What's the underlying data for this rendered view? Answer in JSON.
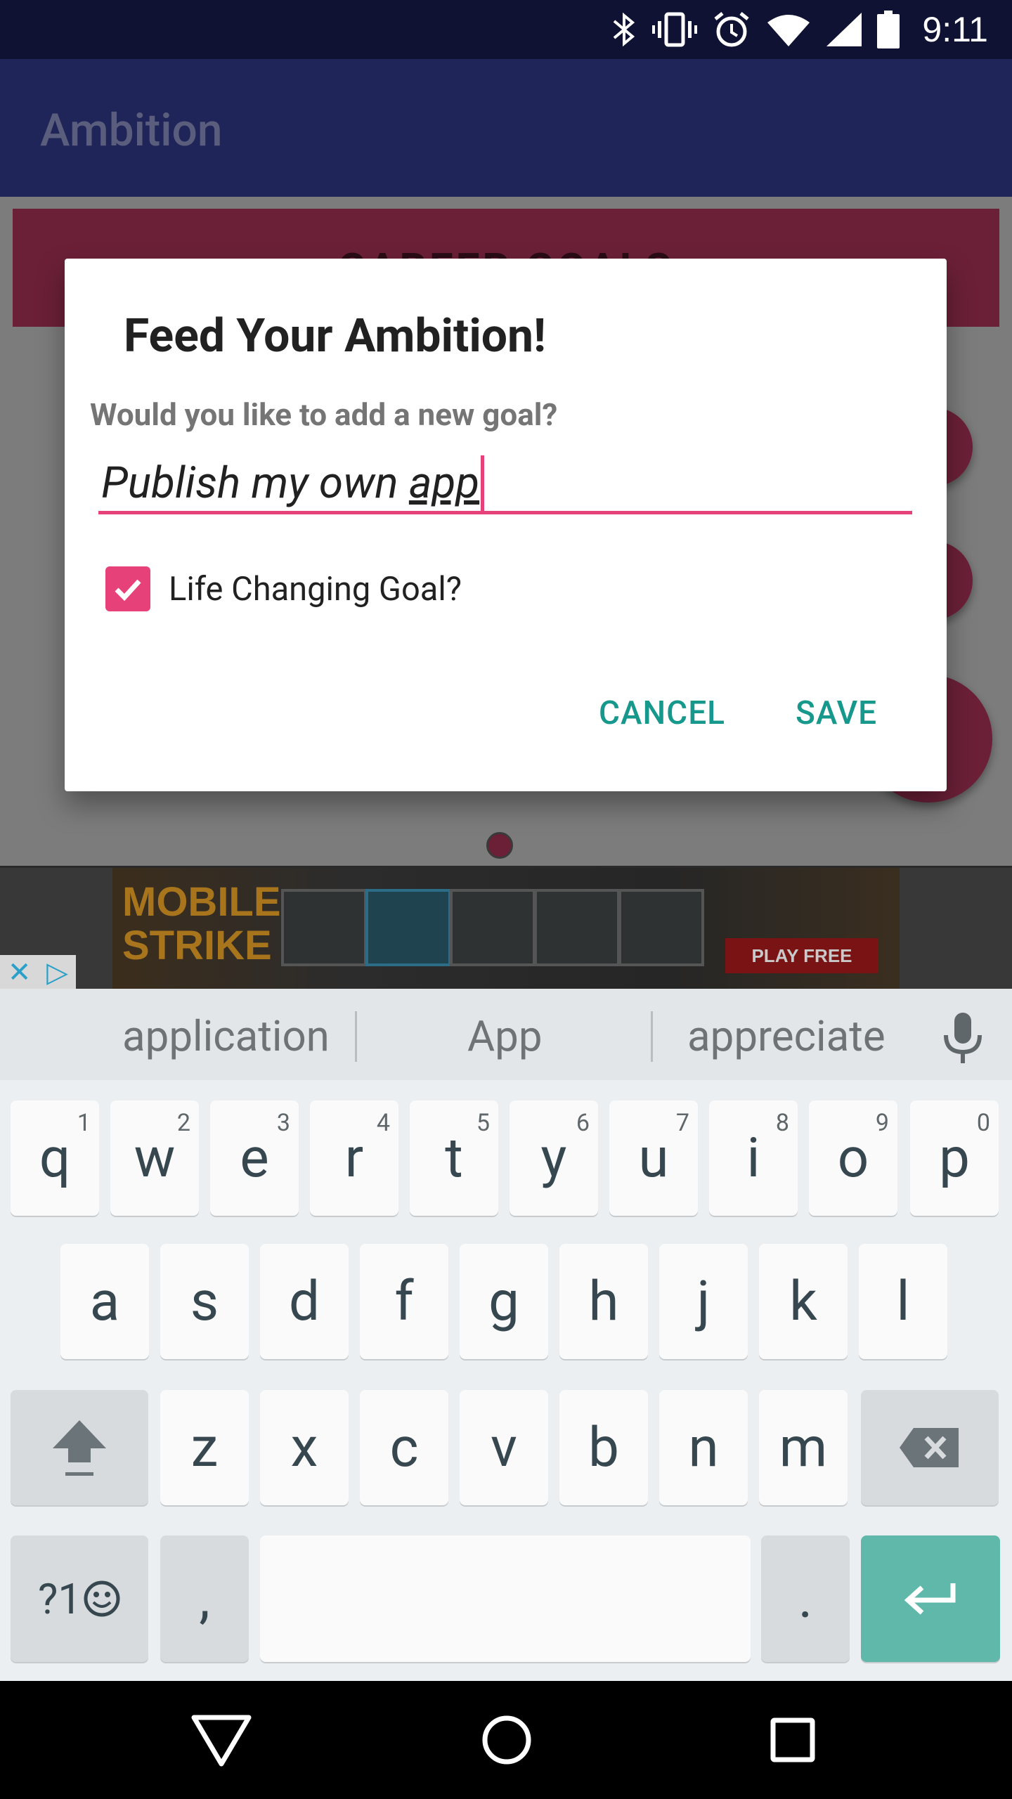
{
  "status_bar": {
    "time": "9:11",
    "icons": [
      "bluetooth-icon",
      "vibrate-icon",
      "alarm-icon",
      "wifi-icon",
      "signal-icon",
      "battery-icon"
    ]
  },
  "app_bar": {
    "title": "Ambition"
  },
  "background": {
    "banner_text": "CAREER GOALS",
    "colors": {
      "banner": "#6b2038",
      "app_bar": "#1f2459"
    }
  },
  "ad": {
    "title_line1": "MOBILE",
    "title_line2": "STRIKE",
    "cta": "PLAY FREE"
  },
  "dialog": {
    "title": "Feed Your Ambition!",
    "message": "Would you like to add a new goal?",
    "input": {
      "value_prefix": "Publish my own ",
      "value_composing": "app"
    },
    "checkbox": {
      "label": "Life Changing Goal?",
      "checked": true
    },
    "buttons": {
      "cancel": "CANCEL",
      "save": "SAVE"
    },
    "colors": {
      "accent": "#e7417a",
      "button": "#17988c"
    }
  },
  "keyboard": {
    "suggestions": [
      "application",
      "App",
      "appreciate"
    ],
    "row1": [
      {
        "key": "q",
        "hint": "1"
      },
      {
        "key": "w",
        "hint": "2"
      },
      {
        "key": "e",
        "hint": "3"
      },
      {
        "key": "r",
        "hint": "4"
      },
      {
        "key": "t",
        "hint": "5"
      },
      {
        "key": "y",
        "hint": "6"
      },
      {
        "key": "u",
        "hint": "7"
      },
      {
        "key": "i",
        "hint": "8"
      },
      {
        "key": "o",
        "hint": "9"
      },
      {
        "key": "p",
        "hint": "0"
      }
    ],
    "row2": [
      "a",
      "s",
      "d",
      "f",
      "g",
      "h",
      "j",
      "k",
      "l"
    ],
    "row3": [
      "z",
      "x",
      "c",
      "v",
      "b",
      "n",
      "m"
    ],
    "row4": {
      "symbols": "?1",
      "comma": ",",
      "period": "."
    },
    "colors": {
      "enter": "#5fb8a9"
    }
  },
  "nav_bar": {
    "icons": [
      "back-icon",
      "home-icon",
      "recents-icon"
    ]
  }
}
